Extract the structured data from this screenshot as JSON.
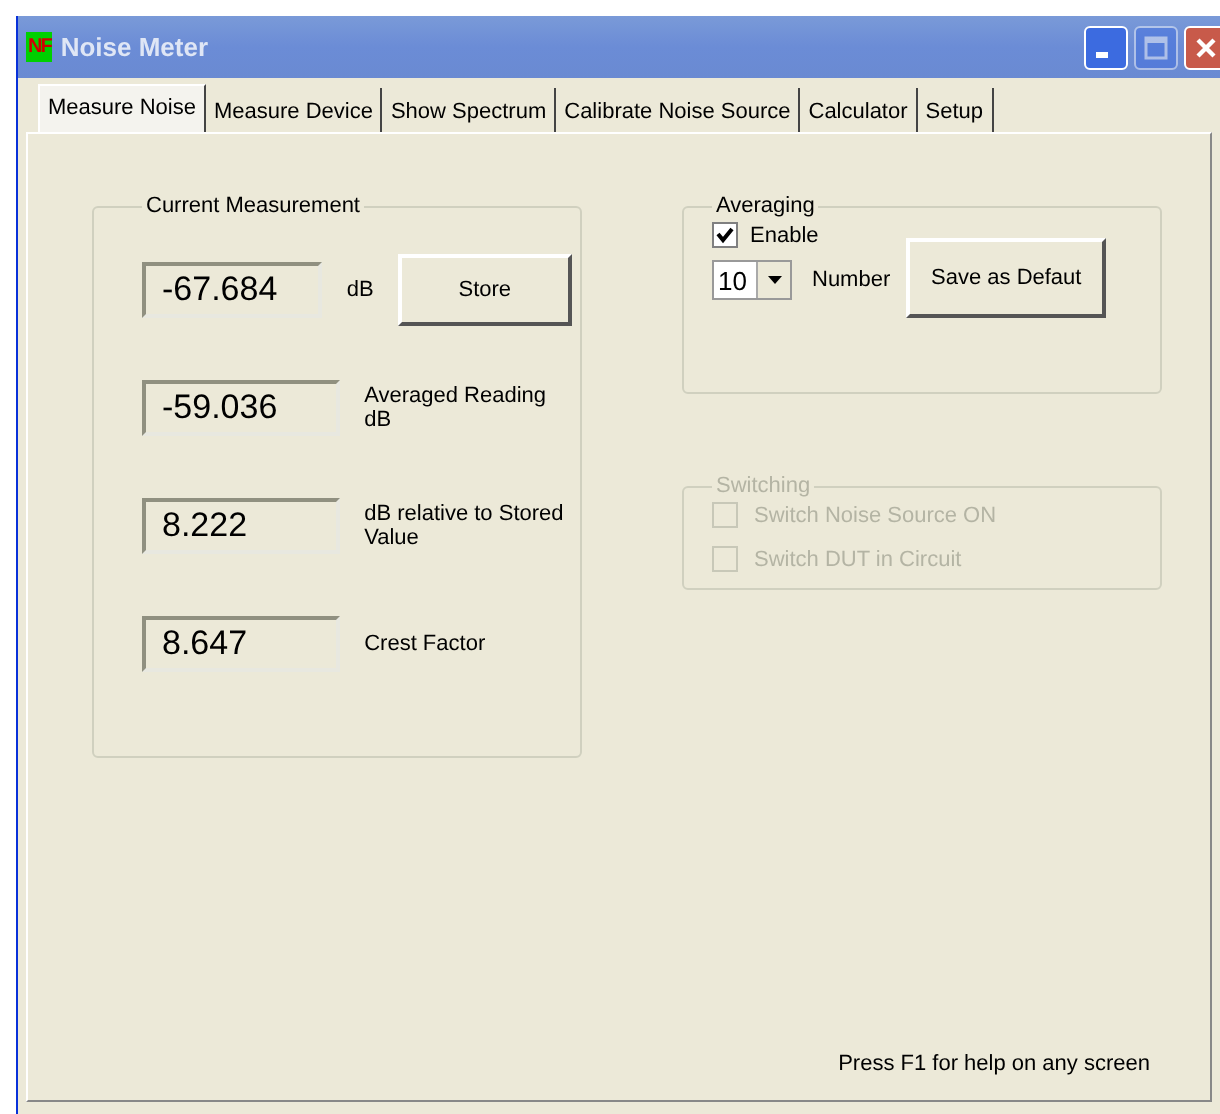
{
  "window": {
    "title": "Noise Meter",
    "app_icon": "NF",
    "controls": [
      {
        "kind": "minimize",
        "disabled": false
      },
      {
        "kind": "maximize",
        "disabled": true
      },
      {
        "kind": "close",
        "disabled": false
      }
    ]
  },
  "tabs": [
    {
      "label": "Measure Noise",
      "selected": true
    },
    {
      "label": "Measure Device",
      "selected": false
    },
    {
      "label": "Show Spectrum",
      "selected": false
    },
    {
      "label": "Calibrate Noise Source",
      "selected": false
    },
    {
      "label": "Calculator",
      "selected": false
    },
    {
      "label": "Setup",
      "selected": false
    }
  ],
  "current_measurement": {
    "title": "Current Measurement",
    "store_button": "Store",
    "rows": [
      {
        "value": "-67.684",
        "label": "dB"
      },
      {
        "value": "-59.036",
        "label": "Averaged Reading dB"
      },
      {
        "value": "8.222",
        "label": "dB relative to Stored Value"
      },
      {
        "value": "8.647",
        "label": "Crest Factor"
      }
    ]
  },
  "averaging": {
    "title": "Averaging",
    "enable": {
      "label": "Enable",
      "checked": true
    },
    "number": {
      "value": "10",
      "label": "Number"
    },
    "save_button": "Save as Defaut"
  },
  "switching": {
    "title": "Switching",
    "disabled": true,
    "items": [
      {
        "label": "Switch Noise Source ON",
        "checked": false
      },
      {
        "label": "Switch DUT in Circuit",
        "checked": false
      }
    ]
  },
  "help_text": "Press F1 for help on any screen"
}
